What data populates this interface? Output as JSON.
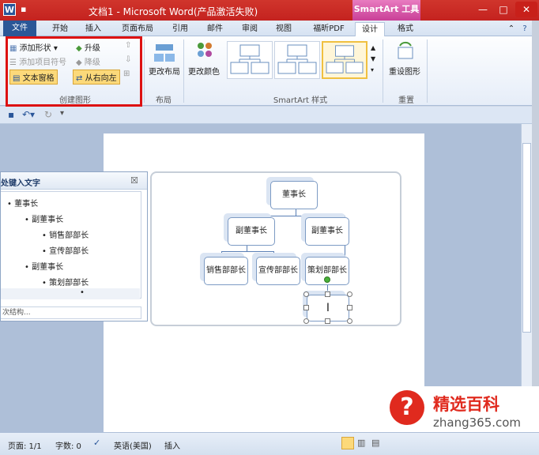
{
  "window": {
    "title": "文档1 - Microsoft Word(产品激活失败)",
    "word_icon_glyph": "W",
    "contextual_tab": "SmartArt 工具"
  },
  "tabs": [
    "文件",
    "开始",
    "插入",
    "页面布局",
    "引用",
    "邮件",
    "审阅",
    "视图",
    "福昕PDF",
    "设计",
    "格式"
  ],
  "ribbon": {
    "create_graphic": {
      "add_shape": "添加形状",
      "promote": "升级",
      "add_bullet": "添加项目符号",
      "demote": "降级",
      "text_pane": "文本窗格",
      "right_to_left": "从右向左",
      "label": "创建图形"
    },
    "layouts": {
      "change_layout": "更改布局",
      "label": "布局"
    },
    "styles": {
      "change_colors": "更改颜色",
      "label": "SmartArt 样式"
    },
    "reset": {
      "reset_graphic": "重设图形",
      "label": "重置"
    }
  },
  "text_pane": {
    "title": "处键入文字",
    "close": "☒",
    "items": [
      "董事长",
      "副董事长",
      "销售部部长",
      "宣传部部长",
      "副董事长",
      "策划部部长",
      ""
    ],
    "footer": "次结构..."
  },
  "diagram": {
    "nodes": [
      "董事长",
      "副董事长",
      "副董事长",
      "销售部部长",
      "宣传部部长",
      "策划部部长",
      ""
    ],
    "cursor": "I"
  },
  "status": {
    "page": "页面: 1/1",
    "words": "字数: 0",
    "language": "英语(美国)",
    "mode": "插入"
  },
  "watermark": {
    "brand": "精选百科",
    "url": "zhang365.com",
    "glyph": "?"
  },
  "colors": {
    "title_red": "#c4221f",
    "smartart_pink": "#c93f97",
    "file_blue": "#2b5797",
    "highlight_red": "#dd1111"
  }
}
